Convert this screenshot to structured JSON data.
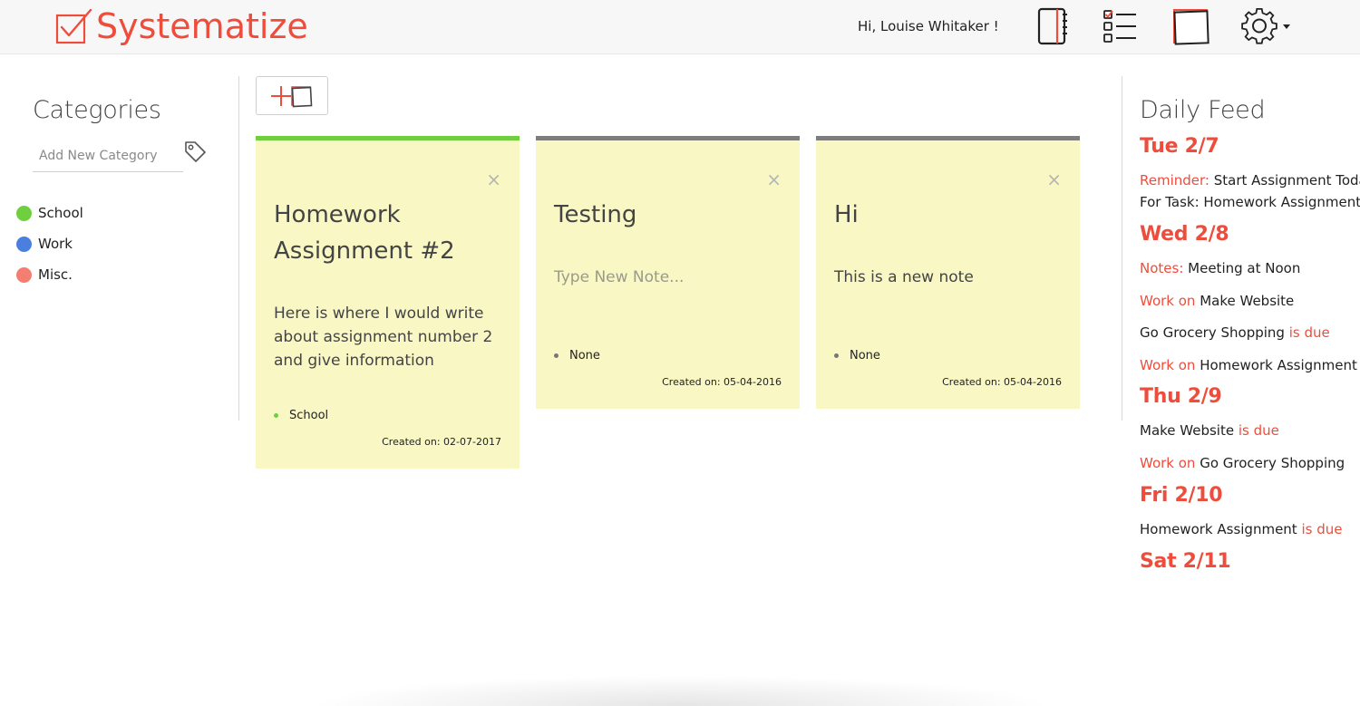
{
  "app": {
    "logo_text": "Systematize",
    "brand_color": "#ef4d3c"
  },
  "header": {
    "greeting": "Hi, Louise Whitaker !",
    "icons": [
      "notebook-icon",
      "checklist-icon",
      "sticky-note-icon",
      "gear-icon"
    ]
  },
  "sidebar": {
    "title": "Categories",
    "add_placeholder": "Add New Category",
    "categories": [
      {
        "label": "School",
        "color": "#6fcf3f"
      },
      {
        "label": "Work",
        "color": "#4a7fe0"
      },
      {
        "label": "Misc.",
        "color": "#f47e72"
      }
    ]
  },
  "notes": [
    {
      "title": "Homework Assignment #2",
      "body": "Here is where I would write about assignment number 2 and give information",
      "body_is_placeholder": false,
      "category": "School",
      "category_color": "#6fcf3f",
      "top_color": "#6fcf3f",
      "created": "Created on: 02-07-2017",
      "close": "×"
    },
    {
      "title": "Testing",
      "body": "Type New Note...",
      "body_is_placeholder": true,
      "category": "None",
      "category_color": "#777777",
      "top_color": "#7d7d7d",
      "created": "Created on: 05-04-2016",
      "close": "×"
    },
    {
      "title": "Hi",
      "body": "This is a new note",
      "body_is_placeholder": false,
      "category": "None",
      "category_color": "#777777",
      "top_color": "#7d7d7d",
      "created": "Created on: 05-04-2016",
      "close": "×"
    }
  ],
  "feed": {
    "title": "Daily Feed",
    "days": [
      {
        "label": "Tue 2/7",
        "lines": [
          {
            "pre": "Reminder:",
            "text": " Start Assignment Today",
            "post": ""
          },
          {
            "pre": "",
            "text": "For Task: Homework Assignment",
            "post": ""
          }
        ]
      },
      {
        "label": "Wed 2/8",
        "lines": [
          {
            "pre": "Notes:",
            "text": " Meeting at Noon",
            "post": ""
          },
          {
            "pre": "Work on",
            "text": " Make Website",
            "post": ""
          },
          {
            "pre": "",
            "text": "Go Grocery Shopping",
            "post": " is due"
          },
          {
            "pre": "Work on",
            "text": " Homework Assignment",
            "post": ""
          }
        ]
      },
      {
        "label": "Thu 2/9",
        "lines": [
          {
            "pre": "",
            "text": "Make Website",
            "post": " is due"
          },
          {
            "pre": "Work on",
            "text": " Go Grocery Shopping",
            "post": ""
          }
        ]
      },
      {
        "label": "Fri 2/10",
        "lines": [
          {
            "pre": "",
            "text": "Homework Assignment",
            "post": " is due"
          }
        ]
      },
      {
        "label": "Sat 2/11",
        "lines": []
      }
    ]
  }
}
